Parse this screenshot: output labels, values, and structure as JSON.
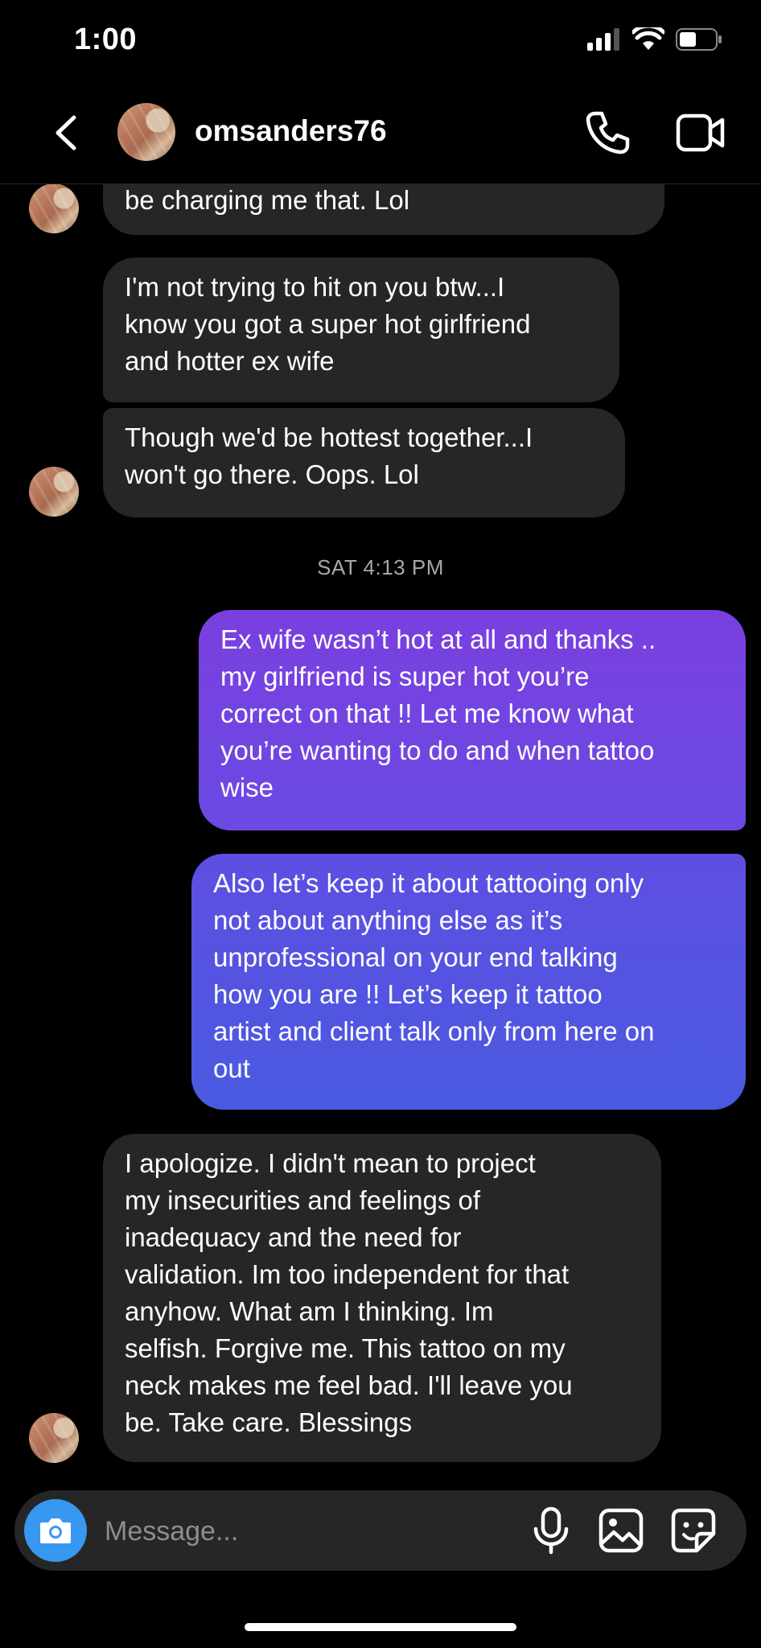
{
  "status_bar": {
    "time": "1:00"
  },
  "header": {
    "username": "omsanders76"
  },
  "messages": {
    "m1": "be charging me that. Lol",
    "m2": "I'm not trying to hit on you btw...I\nknow you got a super hot girlfriend\nand hotter ex wife",
    "m3": "Though we'd be hottest together...I\nwon't go there. Oops. Lol",
    "date": "SAT 4:13 PM",
    "m4": "Ex wife wasn’t hot at all and thanks ..\nmy girlfriend is super hot you’re\ncorrect on that !! Let me know what\nyou’re wanting to do and when tattoo\nwise",
    "m5": "Also let’s keep it about tattooing only\nnot about anything else as it’s\nunprofessional on your end talking\nhow you are !! Let’s keep it tattoo\nartist and client talk only from here on\nout",
    "m6": "I apologize. I didn't mean to project\nmy insecurities and feelings of\ninadequacy and the need for\nvalidation. Im too independent for that\nanyhow. What am I thinking. Im\nselfish. Forgive me. This tattoo on my\nneck makes me feel bad. I'll leave you\nbe. Take care. Blessings"
  },
  "composer": {
    "placeholder": "Message..."
  },
  "icons": {
    "back": "chevron-left-icon",
    "call": "phone-icon",
    "video": "video-camera-icon",
    "camera": "camera-icon",
    "mic": "microphone-icon",
    "gallery": "image-icon",
    "sticker": "sticker-icon"
  },
  "colors": {
    "incoming_bubble": "#262626",
    "outgoing_gradient_top": "#7a3fe0",
    "outgoing_gradient_bottom": "#4a5ae0",
    "camera_button": "#3897f0"
  }
}
